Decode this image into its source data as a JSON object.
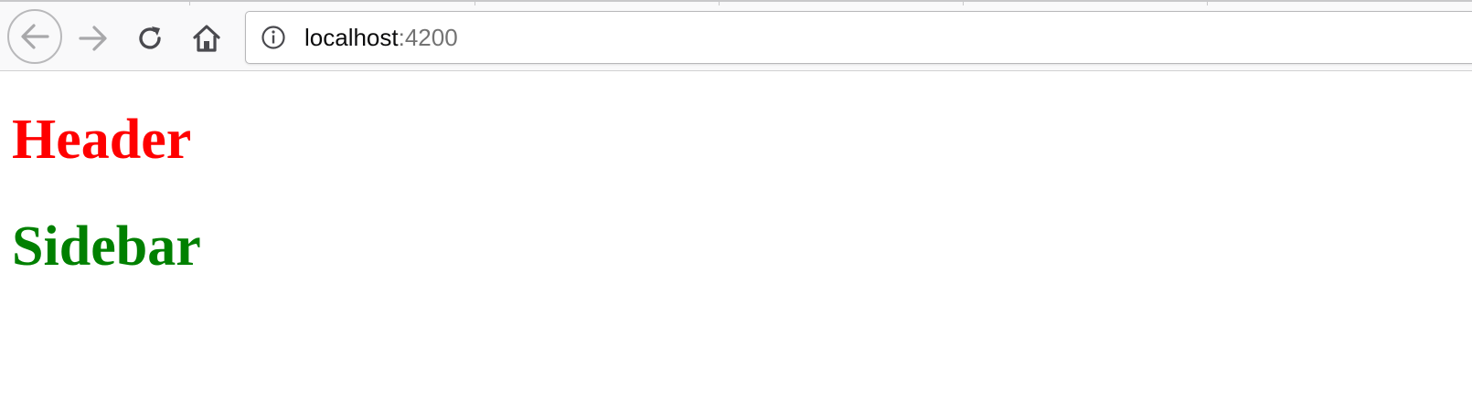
{
  "browser": {
    "url_host": "localhost",
    "url_port": ":4200",
    "icons": {
      "back": "arrow-left-icon",
      "forward": "arrow-right-icon",
      "reload": "reload-icon",
      "home": "home-icon",
      "site_info": "info-icon"
    }
  },
  "page": {
    "header_text": "Header",
    "sidebar_text": "Sidebar"
  },
  "colors": {
    "header": "#ff0000",
    "sidebar": "#008000",
    "toolbar_bg": "#f9f9fa"
  }
}
